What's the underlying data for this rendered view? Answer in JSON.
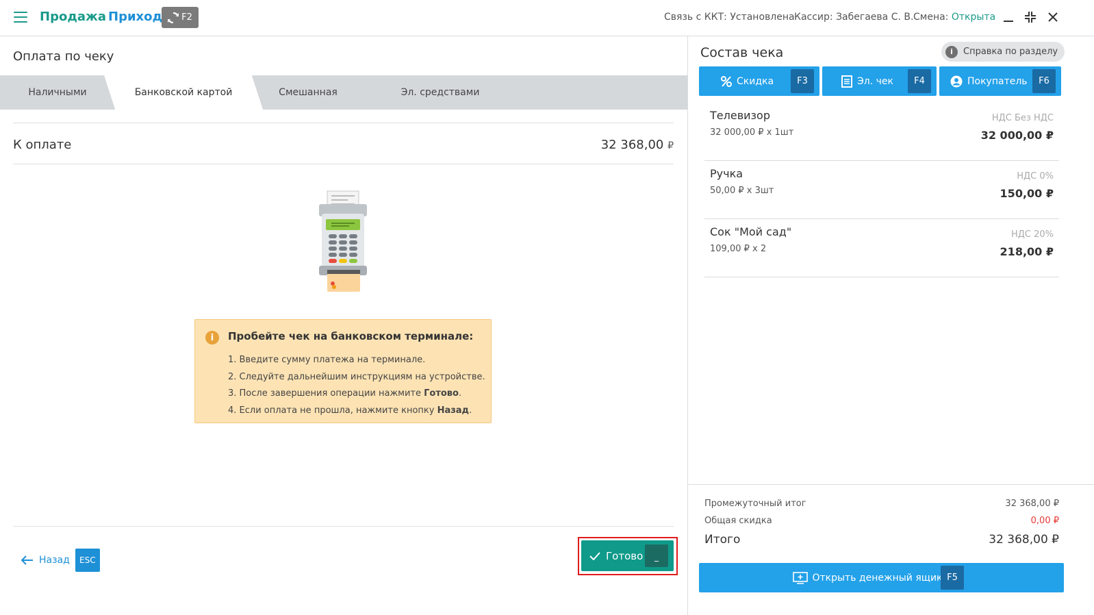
{
  "topbar": {
    "mode_sale": "Продажа",
    "mode_income": "Приход",
    "switch_key": "F2",
    "kkt_status_label": "Связь с ККТ: Установлена",
    "cashier_label": "Кассир: Забегаева С. В.",
    "shift_label": "Смена:",
    "shift_value": "Открыта"
  },
  "payment": {
    "title": "Оплата по чеку",
    "tabs": [
      {
        "label": "Наличными"
      },
      {
        "label": "Банковской картой"
      },
      {
        "label": "Смешанная"
      },
      {
        "label": "Эл. средствами"
      }
    ],
    "active_tab": 1,
    "to_pay_label": "К оплате",
    "to_pay_amount": "32 368,00",
    "currency": "₽",
    "info_title": "Пробейте чек на банковском терминале:",
    "info_steps": [
      {
        "prefix": "1. Введите сумму платежа на терминале.",
        "bold": "",
        "suffix": ""
      },
      {
        "prefix": "2. Следуйте дальнейшим инструкциям на устройстве.",
        "bold": "",
        "suffix": ""
      },
      {
        "prefix": "3. После завершения операции нажмите ",
        "bold": "Готово",
        "suffix": "."
      },
      {
        "prefix": "4. Если оплата не прошла, нажмите кнопку ",
        "bold": "Назад",
        "suffix": "."
      }
    ],
    "back_label": "Назад",
    "back_key": "ESC",
    "done_label": "Готово",
    "done_key": "_"
  },
  "receipt": {
    "title": "Состав чека",
    "help_label": "Справка по разделу",
    "discount_label": "Скидка",
    "discount_key": "F3",
    "echeck_label": "Эл. чек",
    "echeck_key": "F4",
    "buyer_label": "Покупатель",
    "buyer_key": "F6",
    "items": [
      {
        "name": "Телевизор",
        "qty": "32 000,00 ₽ x 1шт",
        "vat": "НДС Без НДС",
        "sum": "32 000,00 ₽"
      },
      {
        "name": "Ручка",
        "qty": "50,00 ₽ x 3шт",
        "vat": "НДС 0%",
        "sum": "150,00 ₽"
      },
      {
        "name": "Сок \"Мой сад\"",
        "qty": "109,00 ₽ x 2",
        "vat": "НДС 20%",
        "sum": "218,00 ₽"
      }
    ],
    "subtotal_label": "Промежуточный итог",
    "subtotal_value": "32 368,00 ₽",
    "discount_total_label": "Общая скидка",
    "discount_total_value": "0,00 ₽",
    "total_label": "Итого",
    "total_value": "32 368,00 ₽",
    "drawer_label": "Открыть денежный ящик",
    "drawer_key": "F5"
  },
  "colors": {
    "teal": "#1a9a8a",
    "blue": "#23a1e9",
    "done_green": "#0f9a8a",
    "highlight_red": "#e01b1b",
    "warning_bg": "#fde3b4"
  }
}
